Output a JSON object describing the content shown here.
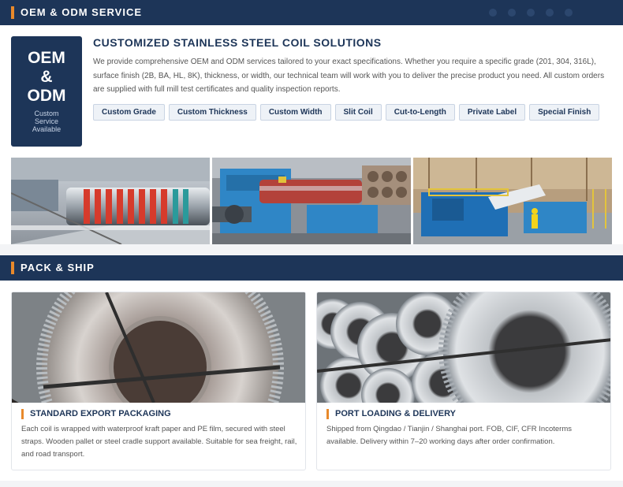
{
  "oem_section": {
    "title": "OEM & ODM SERVICE",
    "badge": {
      "line1": "OEM",
      "line2": "&",
      "line3": "ODM",
      "sub1": "Custom",
      "sub2": "Service",
      "sub3": "Available"
    },
    "heading": "CUSTOMIZED STAINLESS STEEL COIL SOLUTIONS",
    "description": "We provide comprehensive OEM and ODM services tailored to your exact specifications. Whether you require a specific grade (201, 304, 316L), surface finish (2B, BA, HL, 8K), thickness, or width, our technical team will work with you to deliver the precise product you need. All custom orders are supplied with full mill test certificates and quality inspection reports.",
    "tags": [
      "Custom Grade",
      "Custom Thickness",
      "Custom Width",
      "Slit Coil",
      "Cut-to-Length",
      "Private Label",
      "Special Finish"
    ],
    "photos": [
      "coil-slitting-line-photo",
      "blue-slitting-machine-photo",
      "factory-processing-line-photo"
    ]
  },
  "pack_section": {
    "title": "PACK & SHIP",
    "cards": [
      {
        "title": "STANDARD EXPORT PACKAGING",
        "text": "Each coil is wrapped with waterproof kraft paper and PE film, secured with steel straps. Wooden pallet or steel cradle support available. Suitable for sea freight, rail, and road transport."
      },
      {
        "title": "PORT LOADING & DELIVERY",
        "text": "Shipped from Qingdao / Tianjin / Shanghai port. FOB, CIF, CFR Incoterms available. Delivery within 7–20 working days after order confirmation."
      }
    ]
  },
  "colors": {
    "navy": "#1d3558",
    "accent_orange": "#e8892b",
    "machine_blue": "#2f86c6"
  }
}
